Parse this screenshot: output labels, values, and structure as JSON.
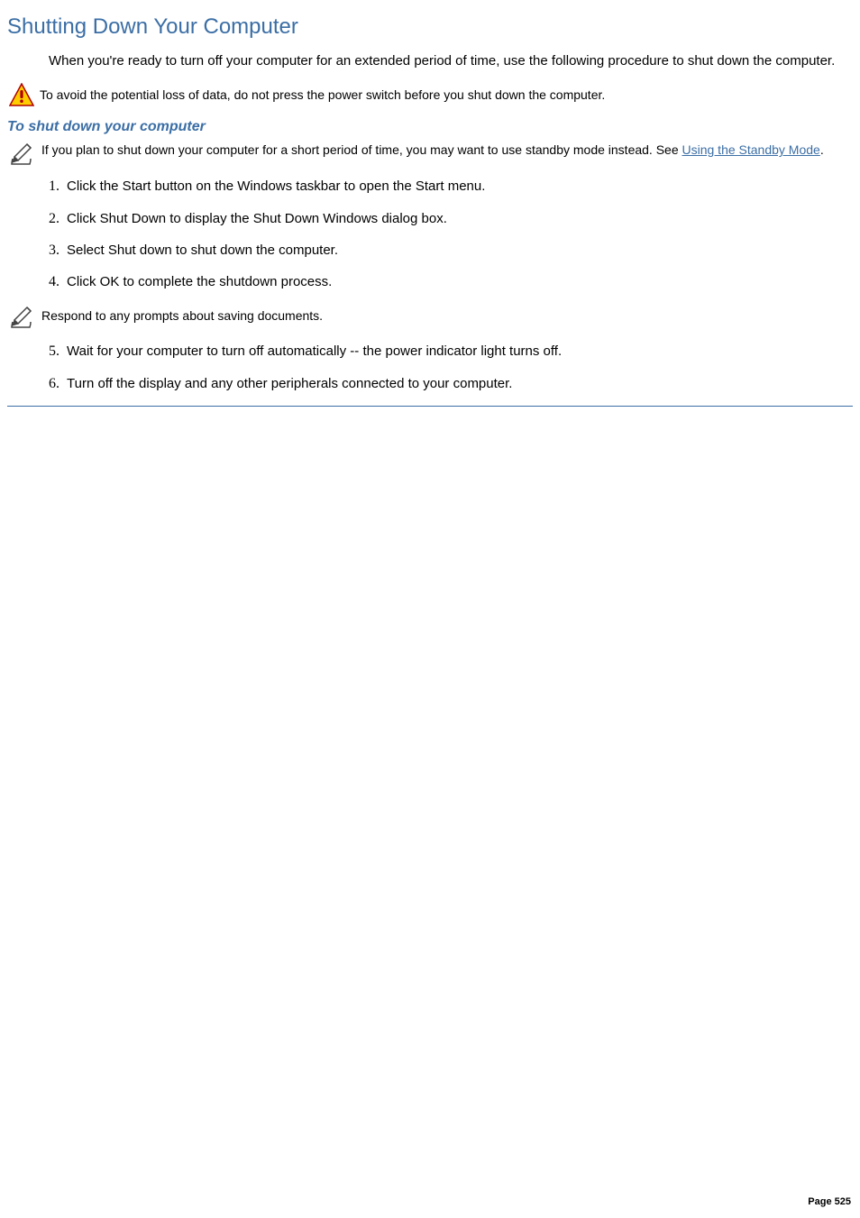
{
  "title": "Shutting Down Your Computer",
  "intro": "When you're ready to turn off your computer for an extended period of time, use the following procedure to shut down the computer.",
  "warning": "To avoid the potential loss of data, do not press the power switch before you shut down the computer.",
  "subheading": "To shut down your computer",
  "note1_pre": "If you plan to shut down your computer for a short period of time, you may want to use standby mode instead. See ",
  "note1_link": "Using the Standby Mode",
  "note1_post": ".",
  "steps_a": [
    "Click the Start button on the Windows taskbar to open the Start menu.",
    "Click Shut Down to display the Shut Down Windows dialog box.",
    "Select Shut down to shut down the computer.",
    "Click OK to complete the shutdown process."
  ],
  "note2": "Respond to any prompts about saving documents.",
  "steps_b": [
    "Wait for your computer to turn off automatically -- the power indicator light turns off.",
    "Turn off the display and any other peripherals connected to your computer."
  ],
  "page_label": "Page 525"
}
